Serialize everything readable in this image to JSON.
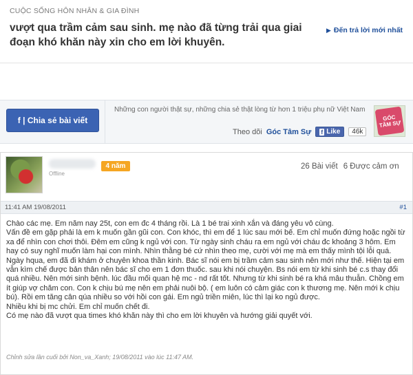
{
  "thread": {
    "breadcrumb": "CUỘC SỐNG HÔN NHÂN & GIA ĐÌNH",
    "title": "vượt qua trầm cảm sau sinh. mẹ nào đã từng trải qua giai đoạn khó khăn này xin cho em lời khuyên.",
    "jump_latest": "Đến trả lời mới nhất"
  },
  "share": {
    "button_label": "f | Chia sẻ bài viết",
    "slogan": "Những con người thật sự, những chia sẻ thật lòng từ hơn 1 triệu phụ nữ Việt Nam",
    "follow_text": "Theo dõi",
    "brand": "Góc Tâm Sự",
    "like_label": "Like",
    "like_count": "46k",
    "logo_line1": "GÓC",
    "logo_line2": "TÂM SỰ"
  },
  "post": {
    "status": "Offline",
    "tenure": "4 năm",
    "posts_count": "26 Bài viết",
    "thanks_count": "6 Được cảm ơn",
    "timestamp": "11:41 AM 19/08/2011",
    "number": "#1",
    "body": [
      "Chào các mẹ. Em năm nay 25t, con em đc 4 tháng rồi. Là 1 bé trai xinh xắn và đáng yêu vô cùng.",
      "Vấn đề em gặp phải là em k muốn gần gũi con. Con khóc, thì em để 1 lúc sau mới bế. Em chỉ muốn đứng hoặc ngồi từ xa để nhìn con chơi thôi. Đêm em cũng k ngủ với con. Từ ngày sinh cháu ra em ngủ với cháu đc khoảng 3 hôm. Em hay có suy nghĩ muốn làm hại con mình. Nhìn thằng bé cứ nhìn theo mẹ, cười với mẹ mà em thấy mình tội lỗi quá.",
      "Ngày hqua, em đã đi khám ở chuyên khoa thần kinh. Bác sĩ nói em bị trầm cảm sau sinh nên mới như thế. Hiện tại em vẫn kìm chế được bản thân nên bác sĩ cho em 1 đơn thuốc. sau khi nói chuyện. Bs nói em từ khi sinh bé c.s thay đổi quá nhiều. Nên mới sinh bệnh. lúc đầu mối quan hệ mc - nd rất tốt. Nhưng từ khi sinh bé ra khá mâu thuẫn. Chồng em ít giúp vợ chăm con. Con k chịu bú mẹ nên em phải nuôi bộ. ( em luôn có cảm giác con k thương mẹ. Nên mới k chịu bú). Rồi em tăng cân qúa nhiều so với hồi con gái. Em ngủ triền miên, lúc thì lại ko ngủ được.",
      "Nhiều khi bị mc chửi. Em chỉ muốn chết đi.",
      "Có mẹ nào đã vượt qua times khó khăn này thì cho em lời khuyên và hướng giải quyết với."
    ],
    "edit_note": "Chỉnh sửa lần cuối bởi Non_va_Xanh; 19/08/2011 vào lúc 11:47 AM."
  },
  "colors": {
    "brand_blue": "#3b63b3",
    "link_blue": "#1f4f9a",
    "badge_orange": "#f5a623",
    "meta_bar": "#eef1f4"
  }
}
